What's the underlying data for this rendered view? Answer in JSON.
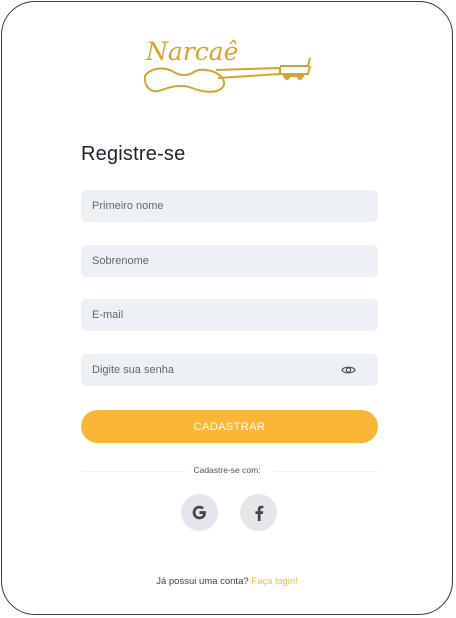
{
  "brand": {
    "logo_text": "Narcaê",
    "accent_color": "#fbb637"
  },
  "form": {
    "title": "Registre-se",
    "fields": [
      {
        "name": "first-name",
        "placeholder": "Primeiro nome",
        "value": ""
      },
      {
        "name": "last-name",
        "placeholder": "Sobrenome",
        "value": ""
      },
      {
        "name": "email",
        "placeholder": "E-mail",
        "value": ""
      },
      {
        "name": "password",
        "placeholder": "Digite sua senha",
        "value": "",
        "icon": "eye-icon"
      }
    ],
    "submit_label": "CADASTRAR"
  },
  "social": {
    "divider_text": "Cadastre-se com:",
    "providers": [
      {
        "name": "google",
        "icon": "google-icon"
      },
      {
        "name": "facebook",
        "icon": "facebook-icon"
      }
    ]
  },
  "footer": {
    "prompt": "Já possui uma conta?",
    "link_label": "Faça login!"
  }
}
